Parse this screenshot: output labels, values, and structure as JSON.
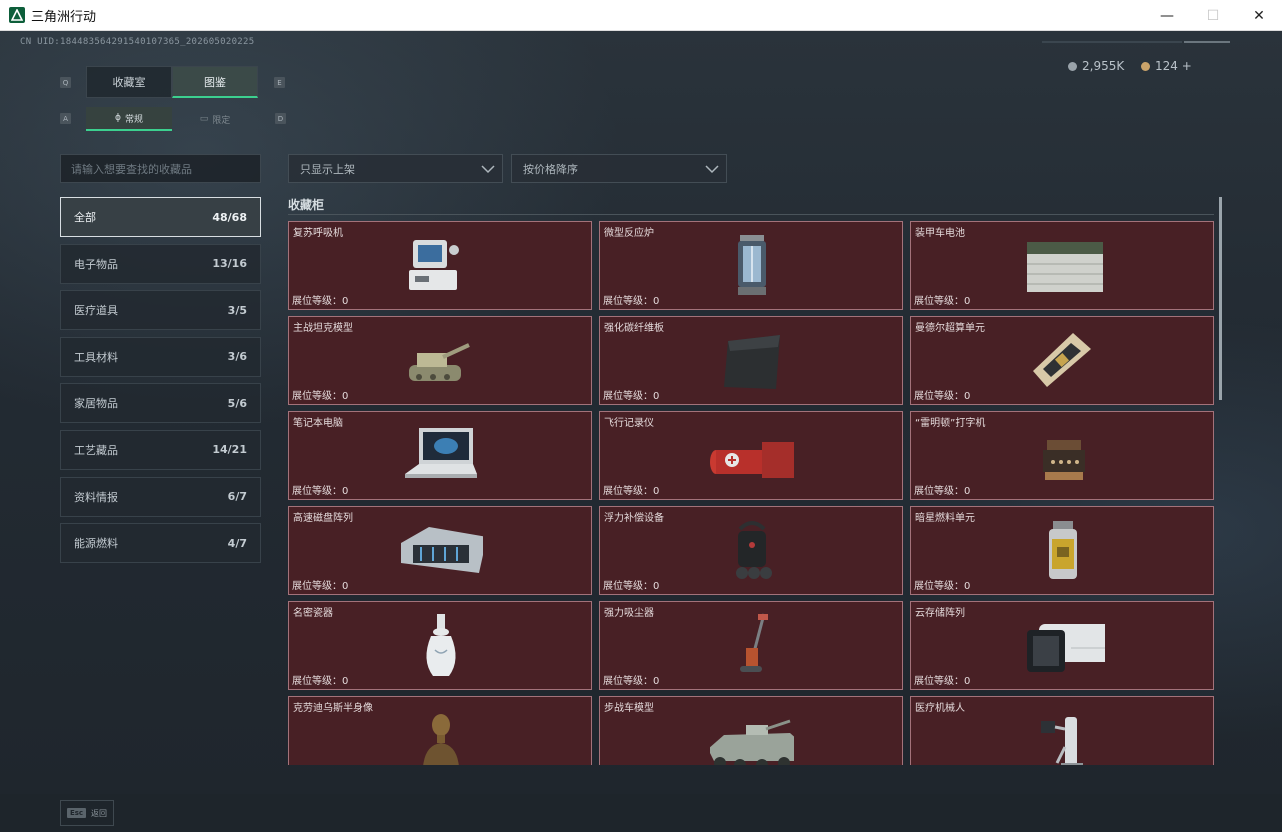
{
  "window": {
    "title": "三角洲行动",
    "controls": {
      "minimize": "—",
      "maximize": "☐",
      "close": "✕"
    }
  },
  "header": {
    "uid": "CN UID:184483564291540107365_202605020225",
    "currency": [
      {
        "icon": "silver-coin-icon",
        "value": "2,955K",
        "color": "#9aa3aa"
      },
      {
        "icon": "gold-coin-icon",
        "value": "124 +",
        "color": "#c9a36a"
      }
    ]
  },
  "key_hints": {
    "tab_prev": "Q",
    "tab_next": "E",
    "sub_prev": "A",
    "sub_next": "D"
  },
  "tabs": [
    {
      "label": "收藏室",
      "active": false
    },
    {
      "label": "图鉴",
      "active": true
    }
  ],
  "sub_tabs": [
    {
      "label": "常规",
      "icon": "flame-icon",
      "active": true
    },
    {
      "label": "限定",
      "icon": "limited-icon",
      "active": false
    }
  ],
  "search": {
    "placeholder": "请输入想要查找的收藏品"
  },
  "categories": [
    {
      "label": "全部",
      "count": "48/68",
      "active": true
    },
    {
      "label": "电子物品",
      "count": "13/16",
      "active": false
    },
    {
      "label": "医疗道具",
      "count": "3/5",
      "active": false
    },
    {
      "label": "工具材料",
      "count": "3/6",
      "active": false
    },
    {
      "label": "家居物品",
      "count": "5/6",
      "active": false
    },
    {
      "label": "工艺藏品",
      "count": "14/21",
      "active": false
    },
    {
      "label": "资料情报",
      "count": "6/7",
      "active": false
    },
    {
      "label": "能源燃料",
      "count": "4/7",
      "active": false
    }
  ],
  "filters": {
    "display": "只显示上架",
    "sort": "按价格降序"
  },
  "section": {
    "title": "收藏柜"
  },
  "items": [
    {
      "name": "复苏呼吸机",
      "level": "展位等级：0",
      "icon": "ventilator-icon"
    },
    {
      "name": "微型反应炉",
      "level": "展位等级：0",
      "icon": "reactor-icon"
    },
    {
      "name": "装甲车电池",
      "level": "展位等级：0",
      "icon": "battery-icon"
    },
    {
      "name": "主战坦克模型",
      "level": "展位等级：0",
      "icon": "tank-model-icon"
    },
    {
      "name": "强化碳纤维板",
      "level": "展位等级：0",
      "icon": "carbon-plate-icon"
    },
    {
      "name": "曼德尔超算单元",
      "level": "展位等级：0",
      "icon": "compute-unit-icon"
    },
    {
      "name": "笔记本电脑",
      "level": "展位等级：0",
      "icon": "laptop-icon"
    },
    {
      "name": "飞行记录仪",
      "level": "展位等级：0",
      "icon": "flight-recorder-icon"
    },
    {
      "name": "“雷明顿”打字机",
      "level": "展位等级：0",
      "icon": "typewriter-icon"
    },
    {
      "name": "高速磁盘阵列",
      "level": "展位等级：0",
      "icon": "disk-array-icon"
    },
    {
      "name": "浮力补偿设备",
      "level": "展位等级：0",
      "icon": "buoyancy-device-icon"
    },
    {
      "name": "暗星燃料单元",
      "level": "展位等级：0",
      "icon": "fuel-cell-icon"
    },
    {
      "name": "名密瓷器",
      "level": "展位等级：0",
      "icon": "porcelain-vase-icon"
    },
    {
      "name": "强力吸尘器",
      "level": "展位等级：0",
      "icon": "vacuum-icon"
    },
    {
      "name": "云存储阵列",
      "level": "展位等级：0",
      "icon": "cloud-storage-icon"
    },
    {
      "name": "克劳迪乌斯半身像",
      "level": "",
      "icon": "bust-icon"
    },
    {
      "name": "步战车模型",
      "level": "",
      "icon": "ifv-model-icon"
    },
    {
      "name": "医疗机械人",
      "level": "",
      "icon": "medical-robot-icon"
    }
  ],
  "bottom": {
    "esc_key": "Esc",
    "esc_label": "返回"
  }
}
